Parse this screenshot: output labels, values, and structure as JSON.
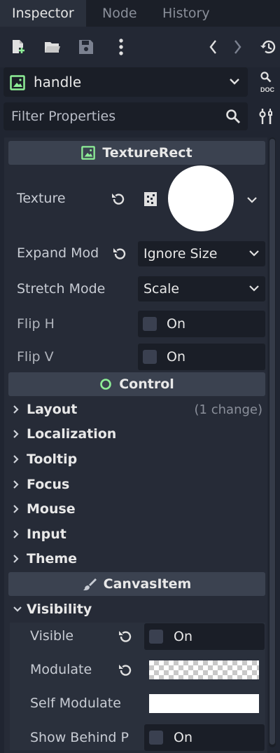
{
  "tabs": [
    {
      "label": "Inspector",
      "active": true
    },
    {
      "label": "Node",
      "active": false
    },
    {
      "label": "History",
      "active": false
    }
  ],
  "toolbar": {
    "icons": [
      "new-resource-icon",
      "open-folder-icon",
      "save-icon",
      "more-vertical-icon",
      "back-icon",
      "forward-icon",
      "history-icon"
    ]
  },
  "node_selector": {
    "name": "handle",
    "doc_label": "DOC"
  },
  "filter": {
    "placeholder": "Filter Properties"
  },
  "sections": {
    "texture_rect": {
      "title": "TextureRect",
      "texture_label": "Texture",
      "expand_mode_label": "Expand Mod",
      "expand_mode_value": "Ignore Size",
      "stretch_mode_label": "Stretch Mode",
      "stretch_mode_value": "Scale",
      "flip_h_label": "Flip H",
      "flip_h_value": "On",
      "flip_v_label": "Flip V",
      "flip_v_value": "On"
    },
    "control": {
      "title": "Control",
      "groups": [
        {
          "label": "Layout",
          "note": "(1 change)"
        },
        {
          "label": "Localization",
          "note": ""
        },
        {
          "label": "Tooltip",
          "note": ""
        },
        {
          "label": "Focus",
          "note": ""
        },
        {
          "label": "Mouse",
          "note": ""
        },
        {
          "label": "Input",
          "note": ""
        },
        {
          "label": "Theme",
          "note": ""
        }
      ]
    },
    "canvas_item": {
      "title": "CanvasItem",
      "visibility_label": "Visibility",
      "visible_label": "Visible",
      "visible_value": "On",
      "modulate_label": "Modulate",
      "self_modulate_label": "Self Modulate",
      "show_behind_label": "Show Behind P",
      "show_behind_value": "On"
    }
  },
  "colors": {
    "accent_green": "#8eef97",
    "background": "#202531",
    "section_header": "#3b4250"
  }
}
